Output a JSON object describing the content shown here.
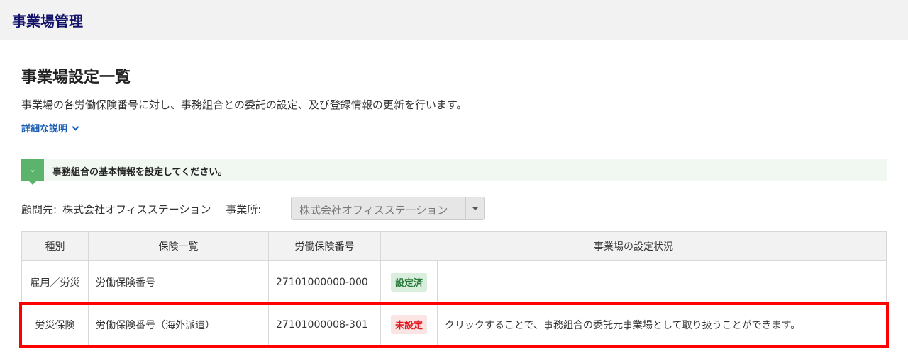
{
  "header": {
    "title": "事業場管理"
  },
  "page": {
    "title": "事業場設定一覧",
    "description": "事業場の各労働保険番号に対し、事務組合との委託の設定、及び登録情報の更新を行います。",
    "details_link": "詳細な説明"
  },
  "notice": {
    "text": "事務組合の基本情報を設定してください。"
  },
  "filters": {
    "client_label": "顧問先:",
    "client_value": "株式会社オフィスステーション",
    "office_label": "事業所:",
    "office_value": "株式会社オフィスステーション"
  },
  "table": {
    "headers": [
      "種別",
      "保険一覧",
      "労働保険番号",
      "事業場の設定状況"
    ],
    "rows": [
      {
        "type": "雇用／労災",
        "insurance": "労働保険番号",
        "number": "27101000000-000",
        "status": "設定済",
        "message": ""
      },
      {
        "type": "労災保険",
        "insurance": "労働保険番号（海外派遣）",
        "number": "27101000008-301",
        "status": "未設定",
        "message": "クリックすることで、事務組合の委託元事業場として取り扱うことができます。"
      }
    ]
  }
}
